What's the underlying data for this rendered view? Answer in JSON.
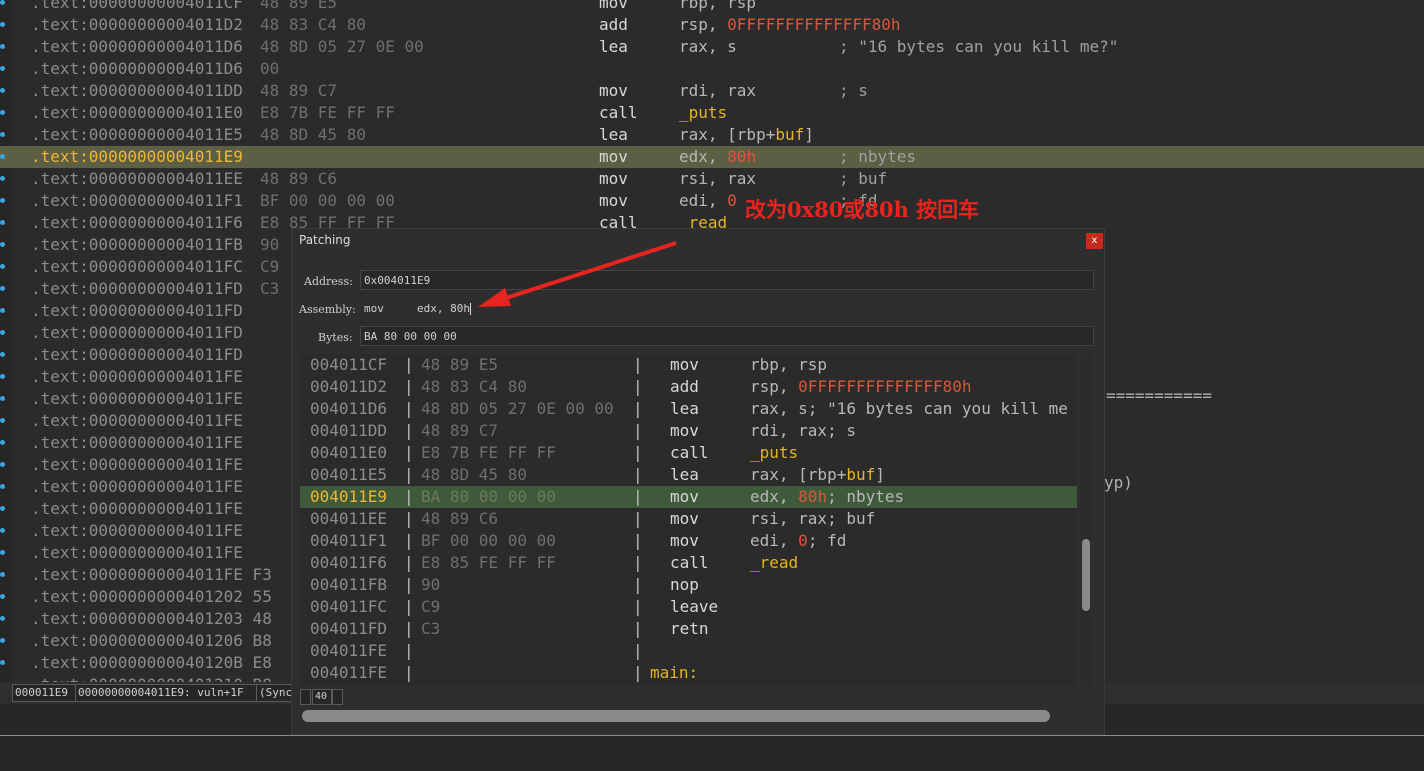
{
  "listing": {
    "rows": [
      {
        "addr": ".text:00000000004011CF",
        "bytes": "48 89 E5",
        "mn": "mov",
        "op": "rbp, rsp",
        "op_color": "",
        "comment": ""
      },
      {
        "addr": ".text:00000000004011D2",
        "bytes": "48 83 C4 80",
        "mn": "add",
        "op_pre": "rsp, ",
        "op_red": "0FFFFFFFFFFFFFF80h",
        "comment": ""
      },
      {
        "addr": ".text:00000000004011D6",
        "bytes": "48 8D 05 27 0E 00",
        "mn": "lea",
        "op": "rax, s",
        "comment": "; \"16 bytes can you kill me?\""
      },
      {
        "addr": ".text:00000000004011D6",
        "bytes": "00",
        "mn": "",
        "op": "",
        "comment": ""
      },
      {
        "addr": ".text:00000000004011DD",
        "bytes": "48 89 C7",
        "mn": "mov",
        "op": "rdi, rax",
        "comment": "; s"
      },
      {
        "addr": ".text:00000000004011E0",
        "bytes": "E8 7B FE FF FF",
        "mn": "call",
        "op_yel": "_puts",
        "comment": ""
      },
      {
        "addr": ".text:00000000004011E5",
        "bytes": "48 8D 45 80",
        "mn": "lea",
        "op_pre": "rax, [rbp+",
        "op_yel": "buf",
        "op_post": "]",
        "comment": ""
      },
      {
        "addr": ".text:00000000004011E9",
        "bytes": "BA 80 00 00 00",
        "mn": "mov",
        "op_pre": "edx, ",
        "op_red": "80h",
        "comment": "; nbytes",
        "highlight": true
      },
      {
        "addr": ".text:00000000004011EE",
        "bytes": "48 89 C6",
        "mn": "mov",
        "op": "rsi, rax",
        "comment": "; buf"
      },
      {
        "addr": ".text:00000000004011F1",
        "bytes": "BF 00 00 00 00",
        "mn": "mov",
        "op_pre": "edi, ",
        "op_red": "0",
        "comment": "; fd"
      },
      {
        "addr": ".text:00000000004011F6",
        "bytes": "E8 85 FF FF FF",
        "mn": "call",
        "op_yel": "_read",
        "comment": ""
      },
      {
        "addr": ".text:00000000004011FB",
        "bytes": "90",
        "mn": "",
        "op": "",
        "comment": ""
      },
      {
        "addr": ".text:00000000004011FC",
        "bytes": "C9",
        "mn": "",
        "op": "",
        "comment": ""
      },
      {
        "addr": ".text:00000000004011FD",
        "bytes": "C3",
        "mn": "",
        "op": "",
        "comment": ""
      },
      {
        "addr": ".text:00000000004011FD",
        "bytes": "",
        "mn": "",
        "op": "",
        "comment": ""
      },
      {
        "addr": ".text:00000000004011FD",
        "bytes": "",
        "mn": "",
        "op": "",
        "comment": ""
      },
      {
        "addr": ".text:00000000004011FD",
        "bytes": "",
        "mn": "",
        "op": "",
        "comment": ""
      },
      {
        "addr": ".text:00000000004011FE",
        "bytes": "",
        "mn": "",
        "op": "",
        "comment": ""
      },
      {
        "addr": ".text:00000000004011FE",
        "bytes": "",
        "mn": "",
        "op": "",
        "comment": ""
      },
      {
        "addr": ".text:00000000004011FE",
        "bytes": "",
        "mn": "",
        "op": "",
        "comment": ""
      },
      {
        "addr": ".text:00000000004011FE",
        "bytes": "",
        "mn": "",
        "op": "",
        "comment": ""
      },
      {
        "addr": ".text:00000000004011FE",
        "bytes": "",
        "mn": "",
        "op": "",
        "comment": ""
      },
      {
        "addr": ".text:00000000004011FE",
        "bytes": "",
        "mn": "",
        "op": "",
        "comment": ""
      },
      {
        "addr": ".text:00000000004011FE",
        "bytes": "",
        "mn": "",
        "op": "",
        "comment": ""
      },
      {
        "addr": ".text:00000000004011FE",
        "bytes": "",
        "mn": "",
        "op": "",
        "comment": ""
      },
      {
        "addr": ".text:00000000004011FE",
        "bytes": "",
        "mn": "",
        "op": "",
        "comment": ""
      },
      {
        "addr": ".text:00000000004011FE F3",
        "bytes": "",
        "mn": "",
        "op": "",
        "comment": ""
      },
      {
        "addr": ".text:0000000000401202 55",
        "bytes": "",
        "mn": "",
        "op": "",
        "comment": ""
      },
      {
        "addr": ".text:0000000000401203 48",
        "bytes": "",
        "mn": "",
        "op": "",
        "comment": ""
      },
      {
        "addr": ".text:0000000000401206 B8",
        "bytes": "",
        "mn": "",
        "op": "",
        "comment": ""
      },
      {
        "addr": ".text:000000000040120B E8",
        "bytes": "",
        "mn": "",
        "op": "",
        "comment": ""
      },
      {
        "addr": ".text:0000000000401210 B8",
        "bytes": "",
        "mn": "",
        "op": "",
        "comment": ""
      }
    ]
  },
  "right_fragments": {
    "separator": "===========",
    "paren": "yp)"
  },
  "statusbar": {
    "offset": "000011E9",
    "location": "00000000004011E9: vuln+1F",
    "sync": "(Sync"
  },
  "annotation": {
    "text": "改为0x80或80h 按回车"
  },
  "dialog": {
    "title": "Patching",
    "close_label": "x",
    "address_label": "Address:",
    "address_value": "0x004011E9",
    "assembly_label": "Assembly:",
    "assembly_value": "mov     edx, 80h",
    "bytes_label": "Bytes:",
    "bytes_value": "BA 80 00 00 00",
    "rows": [
      {
        "a": "004011CF",
        "b": "48 89 E5",
        "m": "mov",
        "o_pre": "rbp, rsp"
      },
      {
        "a": "004011D2",
        "b": "48 83 C4 80",
        "m": "add",
        "o_pre": "rsp, ",
        "o_red": "0FFFFFFFFFFFFFF80h"
      },
      {
        "a": "004011D6",
        "b": "48 8D 05 27 0E 00 00",
        "m": "lea",
        "o_pre": "rax, s; \"16 bytes can you kill me"
      },
      {
        "a": "004011DD",
        "b": "48 89 C7",
        "m": "mov",
        "o_pre": "rdi, rax; s"
      },
      {
        "a": "004011E0",
        "b": "E8 7B FE FF FF",
        "m": "call",
        "o_yel": "_puts"
      },
      {
        "a": "004011E5",
        "b": "48 8D 45 80",
        "m": "lea",
        "o_pre": "rax, [rbp+",
        "o_yel": "buf",
        "o_post": "]"
      },
      {
        "a": "004011E9",
        "b": "BA 80 00 00 00",
        "m": "mov",
        "o_pre": "edx, ",
        "o_red": "80h",
        "o_post": "; nbytes",
        "highlight": true
      },
      {
        "a": "004011EE",
        "b": "48 89 C6",
        "m": "mov",
        "o_pre": "rsi, rax; buf"
      },
      {
        "a": "004011F1",
        "b": "BF 00 00 00 00",
        "m": "mov",
        "o_pre": "edi, ",
        "o_red": "0",
        "o_post": "; fd"
      },
      {
        "a": "004011F6",
        "b": "E8 85 FE FF FF",
        "m": "call",
        "o_yel": "_read"
      },
      {
        "a": "004011FB",
        "b": "90",
        "m": "nop"
      },
      {
        "a": "004011FC",
        "b": "C9",
        "m": "leave"
      },
      {
        "a": "004011FD",
        "b": "C3",
        "m": "retn"
      },
      {
        "a": "004011FE",
        "b": "",
        "m": ""
      },
      {
        "a": "004011FE",
        "b": "",
        "m": "",
        "label": "main:"
      }
    ],
    "zoom": "40"
  },
  "colors": {
    "highlight_row": "#5c5f44",
    "dialog_highlight_row": "#3e5a3a",
    "address_highlight": "#f0b533",
    "immediate_red": "#d9573c",
    "name_yellow": "#e6b422",
    "annotation_red": "#e8241e"
  }
}
